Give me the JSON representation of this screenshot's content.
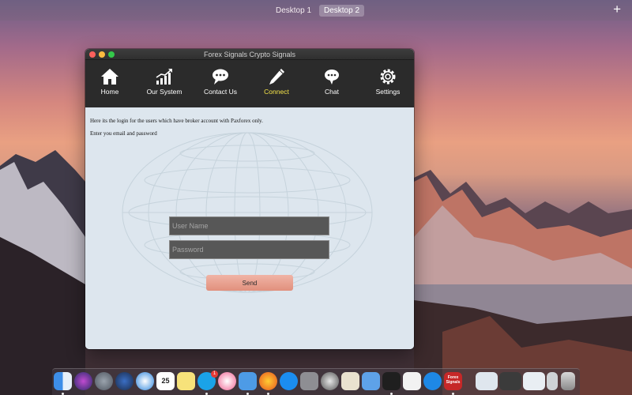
{
  "mission_control": {
    "desktop1": "Desktop 1",
    "desktop2": "Desktop 2",
    "add_symbol": "+"
  },
  "window": {
    "title": "Forex Signals Crypto Signals",
    "toolbar": [
      {
        "label": "Home",
        "icon": "home-icon"
      },
      {
        "label": "Our System",
        "icon": "bar-chart-icon"
      },
      {
        "label": "Contact Us",
        "icon": "speech-bubble-icon"
      },
      {
        "label": "Connect",
        "icon": "pen-icon",
        "active": true
      },
      {
        "label": "Chat",
        "icon": "chat-bubble-icon"
      },
      {
        "label": "Settings",
        "icon": "gear-icon"
      }
    ],
    "content": {
      "message": "Here its the login for the users which have broker account with Paxforex only.",
      "instruction": "Enter you email and password",
      "username_placeholder": "User Name",
      "password_placeholder": "Password",
      "send_label": "Send"
    }
  },
  "dock": {
    "calendar_day": "25",
    "skype_badge": "1",
    "forex_app_label": "Forex Signals"
  },
  "colors": {
    "toolbar_bg": "#2b2b2b",
    "active_label": "#f5e44a",
    "content_bg": "#dde6ee",
    "send_button": "#e9a08e"
  }
}
